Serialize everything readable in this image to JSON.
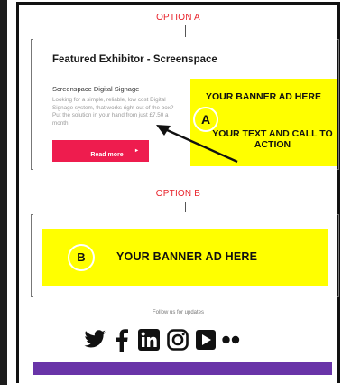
{
  "option_a": {
    "label": "OPTION A",
    "exhibitor_title": "Featured Exhibitor - Screenspace",
    "subtitle": "Screenspace Digital Signage",
    "body": "Looking for a simple, reliable, low cost Digital Signage system, that works right out of the box? Put the solution in your hand from just £7.50 a month.",
    "read_more_label": "Read more",
    "read_more_arrow": "▸",
    "banner_line1": "YOUR BANNER AD HERE",
    "banner_line2": "YOUR TEXT AND CALL TO ACTION",
    "badge": "A"
  },
  "option_b": {
    "label": "OPTION B",
    "banner_text": "YOUR BANNER AD HERE",
    "badge": "B"
  },
  "footer": {
    "follow_text": "Follow us for updates",
    "social_icons": [
      "twitter-icon",
      "facebook-icon",
      "linkedin-icon",
      "instagram-icon",
      "youtube-icon",
      "flickr-icon"
    ]
  },
  "colors": {
    "option_label": "#e8242c",
    "banner_yellow": "#ffff00",
    "read_more_button": "#ee1c4e",
    "footer_bar": "#6934a8",
    "frame": "#111111"
  }
}
